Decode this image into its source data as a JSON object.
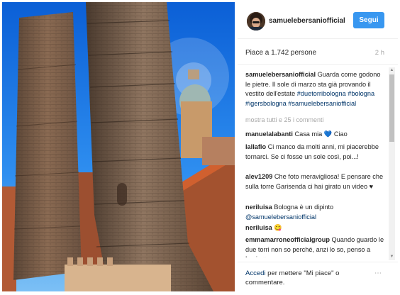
{
  "header": {
    "username": "samuelebersaniofficial",
    "follow_label": "Segui"
  },
  "post": {
    "likes": "Piace a 1.742 persone",
    "time": "2 h"
  },
  "caption": {
    "user": "samuelebersaniofficial",
    "text": "Guarda come godono le pietre. Il sole di marzo sta già provando il vestito dell'estate",
    "hashtags": "#duetorribologna #bologna #igersbologna #samuelebersaniofficial"
  },
  "more_comments": "mostra tutti e 25 i commenti",
  "comments": [
    {
      "user": "manuelalabanti",
      "text": "Casa mia",
      "emoji": "💙",
      "after": "Ciao"
    },
    {
      "user": "lallaflo",
      "text": "Ci manco da molti anni, mi piacerebbe tornarci. Se ci fosse un sole così, poi...!"
    },
    {
      "user": "alev1209",
      "text": "Che foto meravigliosa! E pensare che sulla torre Garisenda ci hai girato un video",
      "emoji": "♥"
    },
    {
      "user": "neriluisa",
      "text": "Bologna è un dipinto",
      "mention": "@samuelebersaniofficial"
    },
    {
      "user": "neriluisa",
      "text": "",
      "emoji": "😋"
    },
    {
      "user": "emmamarroneofficialgroup",
      "text": "Quando guardo le due torri non so perché, anzi lo so, penso a Lucio",
      "emoji": "♥"
    }
  ],
  "footer": {
    "login_link": "Accedi",
    "text": "per mettere \"Mi piace\" o commentare.",
    "more_icon": "⋯"
  },
  "colors": {
    "follow_button": "#3897f0",
    "link": "#003569",
    "muted": "#a8a8a8"
  }
}
